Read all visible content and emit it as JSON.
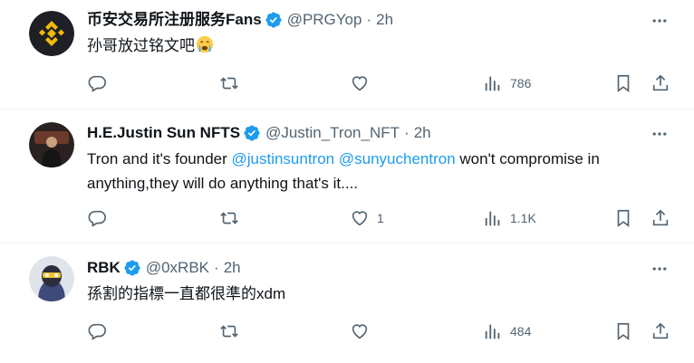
{
  "tweets": [
    {
      "name": "币安交易所注册服务Fans",
      "handle": "@PRGYop",
      "sep": "·",
      "time": "2h",
      "text": "孙哥放过铭文吧",
      "emoji": "crying-face-emoji",
      "replies": "",
      "retweets": "",
      "likes": "",
      "views": "786"
    },
    {
      "name": "H.E.Justin Sun NFTS",
      "handle": "@Justin_Tron_NFT",
      "sep": "·",
      "time": "2h",
      "text_parts": {
        "pre": "Tron and it's founder ",
        "mention1": "@justinsuntron",
        "space": " ",
        "mention2": "@sunyuchentron",
        "post": " won't compromise in anything,they will do anything that's it...."
      },
      "replies": "",
      "retweets": "",
      "likes": "1",
      "views": "1.1K"
    },
    {
      "name": "RBK",
      "handle": "@0xRBK",
      "sep": "·",
      "time": "2h",
      "text": "孫割的指標一直都很準的xdm",
      "replies": "",
      "retweets": "",
      "likes": "",
      "views": "484"
    }
  ],
  "icons": {
    "verified": "verified-badge-icon",
    "more": "more-icon",
    "reply": "reply-icon",
    "retweet": "retweet-icon",
    "like": "like-icon",
    "views": "views-icon",
    "bookmark": "bookmark-icon",
    "share": "share-icon"
  },
  "colors": {
    "verified": "#1d9bf0",
    "mention": "#1d9bf0",
    "muted": "#536471",
    "binance_yellow": "#f0b90b"
  }
}
